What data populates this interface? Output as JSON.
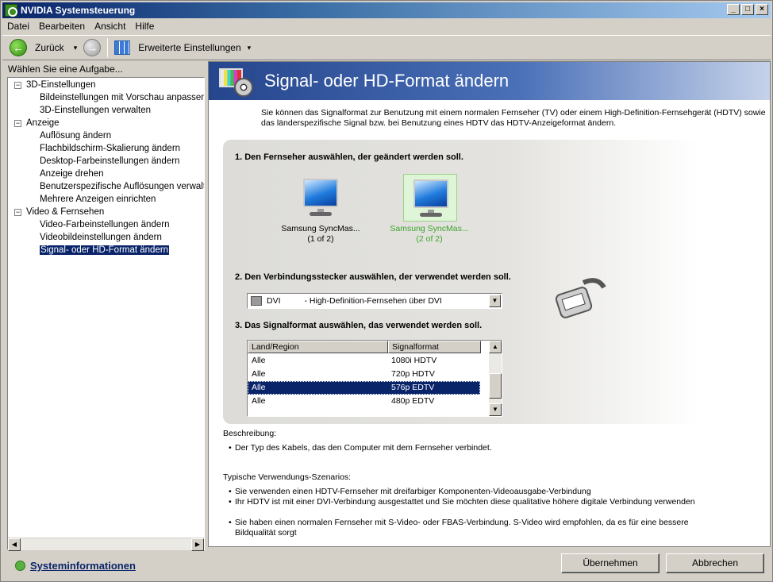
{
  "window": {
    "title": "NVIDIA Systemsteuerung",
    "min": "_",
    "max": "□",
    "close": "×"
  },
  "menu": [
    "Datei",
    "Bearbeiten",
    "Ansicht",
    "Hilfe"
  ],
  "toolbar": {
    "back_label": "Zurück",
    "dropdown": "▾",
    "advanced_label": "Erweiterte Einstellungen"
  },
  "sidebar": {
    "heading": "Wählen Sie eine Aufgabe...",
    "groups": [
      {
        "label": "3D-Einstellungen",
        "items": [
          "Bildeinstellungen mit Vorschau anpassen",
          "3D-Einstellungen verwalten"
        ]
      },
      {
        "label": "Anzeige",
        "items": [
          "Auflösung ändern",
          "Flachbildschirm-Skalierung ändern",
          "Desktop-Farbeinstellungen ändern",
          "Anzeige drehen",
          "Benutzerspezifische Auflösungen verwalten",
          "Mehrere Anzeigen einrichten"
        ]
      },
      {
        "label": "Video & Fernsehen",
        "items": [
          "Video-Farbeinstellungen ändern",
          "Videobildeinstellungen ändern",
          "Signal- oder HD-Format ändern"
        ]
      }
    ],
    "selected": "Signal- oder HD-Format ändern",
    "sysinfo": "Systeminformationen"
  },
  "main": {
    "title": "Signal- oder HD-Format ändern",
    "intro": "Sie können das Signalformat zur Benutzung mit einem normalen Fernseher (TV) oder einem High-Definition-Fernsehgerät (HDTV) sowie das länderspezifische Signal bzw. bei Benutzung eines HDTV das HDTV-Anzeigeformat ändern.",
    "step1": "1. Den Fernseher auswählen, der geändert werden soll.",
    "tv1": {
      "name": "Samsung SyncMas...",
      "index": "(1 of 2)"
    },
    "tv2": {
      "name": "Samsung SyncMas...",
      "index": "(2 of 2)"
    },
    "step2": "2. Den Verbindungsstecker auswählen, der verwendet werden soll.",
    "connector": {
      "type": "DVI",
      "desc": "- High-Definition-Fernsehen über DVI"
    },
    "step3": "3. Das Signalformat auswählen, das verwendet werden soll.",
    "list_headers": [
      "Land/Region",
      "Signalformat"
    ],
    "list_rows": [
      [
        "Alle",
        "1080i HDTV"
      ],
      [
        "Alle",
        "720p HDTV"
      ],
      [
        "Alle",
        "576p EDTV"
      ],
      [
        "Alle",
        "480p EDTV"
      ]
    ],
    "selected_row": 2,
    "description_label": "Beschreibung:",
    "description_bullets": [
      "Der Typ des Kabels, das den Computer mit dem Fernseher verbindet."
    ],
    "scenarios_label": "Typische Verwendungs-Szenarios:",
    "scenarios": [
      "Sie verwenden einen HDTV-Fernseher mit dreifarbiger Komponenten-Videoausgabe-Verbindung",
      "Ihr HDTV ist mit einer DVI-Verbindung ausgestattet und Sie möchten diese qualitative höhere digitale Verbindung verwenden",
      "Sie haben einen normalen Fernseher mit S-Video- oder FBAS-Verbindung. S-Video wird empfohlen, da es für eine bessere Bildqualität sorgt"
    ]
  },
  "buttons": {
    "apply": "Übernehmen",
    "cancel": "Abbrechen"
  },
  "colors": {
    "selection": "#0a246a",
    "selected_tv_text": "#3aa52a",
    "banner": "#25458c"
  }
}
